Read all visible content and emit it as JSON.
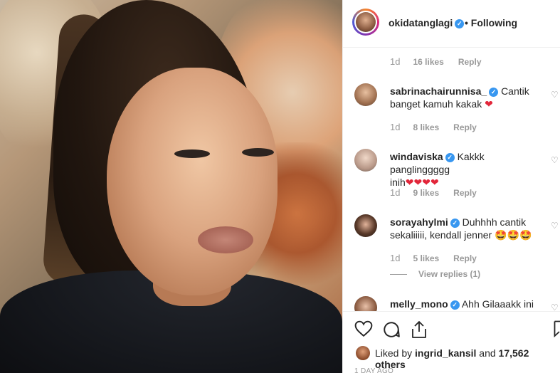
{
  "post": {
    "author": "okidatanglagi",
    "follow_status": "• Following"
  },
  "comments_top_meta": {
    "time": "1d",
    "likes": "16 likes",
    "reply": "Reply"
  },
  "comments": [
    {
      "user": "sabrinachairunnisa_",
      "text_a": "Cantik",
      "text_b": "banget kamuh kakak",
      "emoji": "❤",
      "time": "1d",
      "likes": "8 likes",
      "reply": "Reply"
    },
    {
      "user": "windaviska",
      "text_a": "Kakkk panglinggggg",
      "text_b": "inih",
      "emoji": "❤❤❤❤",
      "time": "1d",
      "likes": "9 likes",
      "reply": "Reply"
    },
    {
      "user": "sorayahylmi",
      "text_a": "Duhhhh cantik",
      "text_b": "sekaliiiii, kendall jenner",
      "emoji": "🤩🤩🤩",
      "time": "1d",
      "likes": "5 likes",
      "reply": "Reply",
      "view_replies": "View replies (1)"
    },
    {
      "user": "melly_mono",
      "text_a": "Ahh Gilaaakk ini"
    }
  ],
  "likes_bar": {
    "prefix": "Liked by",
    "liker": "ingrid_kansil",
    "conj": "and",
    "others": "17,562 others"
  },
  "timestamp": "1 DAY AGO",
  "colors": {
    "verified": "#3897f0",
    "heart": "#e2263a",
    "muted": "#999999"
  }
}
